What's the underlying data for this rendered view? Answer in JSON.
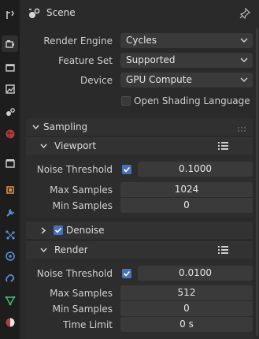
{
  "header": {
    "title": "Scene"
  },
  "tabs": [
    "tool-icon",
    "render-icon",
    "output-icon",
    "view-layer-icon",
    "scene-icon",
    "world-icon",
    "collection-icon",
    "object-icon",
    "modifier-icon",
    "particles-icon",
    "physics-icon",
    "constraints-icon",
    "data-icon",
    "material-icon"
  ],
  "render": {
    "engine_label": "Render Engine",
    "engine_value": "Cycles",
    "feature_label": "Feature Set",
    "feature_value": "Supported",
    "device_label": "Device",
    "device_value": "GPU Compute",
    "osl_label": "Open Shading Language"
  },
  "sampling": {
    "title": "Sampling",
    "viewport": {
      "title": "Viewport",
      "noise_label": "Noise Threshold",
      "noise_value": "0.1000",
      "max_label": "Max Samples",
      "max_value": "1024",
      "min_label": "Min Samples",
      "min_value": "0",
      "denoise_label": "Denoise"
    },
    "render": {
      "title": "Render",
      "noise_label": "Noise Threshold",
      "noise_value": "0.0100",
      "max_label": "Max Samples",
      "max_value": "512",
      "min_label": "Min Samples",
      "min_value": "0",
      "time_label": "Time Limit",
      "time_value": "0 s"
    }
  },
  "colors": {
    "accent": "#4772b3",
    "panel": "#2a2a2a",
    "field": "#3a3a3a"
  }
}
